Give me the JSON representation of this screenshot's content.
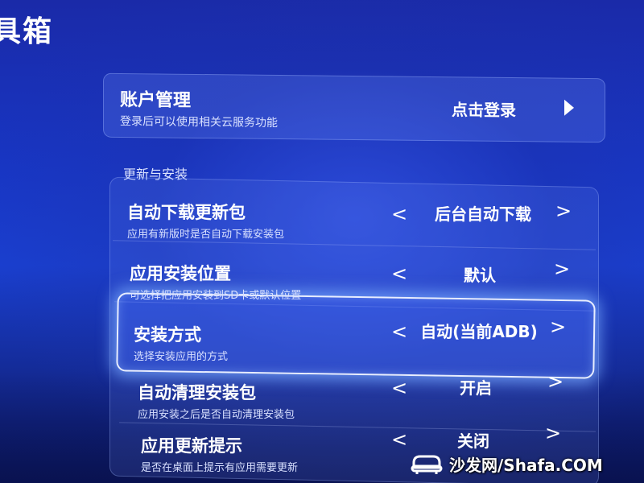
{
  "page": {
    "title": "具箱"
  },
  "account": {
    "title": "账户管理",
    "description": "登录后可以使用相关云服务功能",
    "action": "点击登录",
    "action_icon": "play-right-icon"
  },
  "section": {
    "label": "更新与安装"
  },
  "settings": [
    {
      "label": "自动下载更新包",
      "description": "应用有新版时是否自动下载安装包",
      "value": "后台自动下载",
      "left_arrow": "<",
      "right_arrow": ">"
    },
    {
      "label": "应用安装位置",
      "description": "可选择把应用安装到SD卡或默认位置",
      "value": "默认",
      "left_arrow": "<",
      "right_arrow": ">"
    },
    {
      "label": "安装方式",
      "description": "选择安装应用的方式",
      "value": "自动(当前ADB)",
      "left_arrow": "<",
      "right_arrow": ">",
      "focused": true
    },
    {
      "label": "自动清理安装包",
      "description": "应用安装之后是否自动清理安装包",
      "value": "开启",
      "left_arrow": "<",
      "right_arrow": ">"
    },
    {
      "label": "应用更新提示",
      "description": "是否在桌面上提示有应用需要更新",
      "value": "关闭",
      "left_arrow": "<",
      "right_arrow": ">"
    }
  ],
  "watermark": {
    "text": "沙发网/Shafa.COM",
    "icon": "sofa-logo-icon"
  },
  "colors": {
    "background": "#1a3fcf",
    "focus_glow": "#78aaff",
    "text": "#ffffff"
  }
}
